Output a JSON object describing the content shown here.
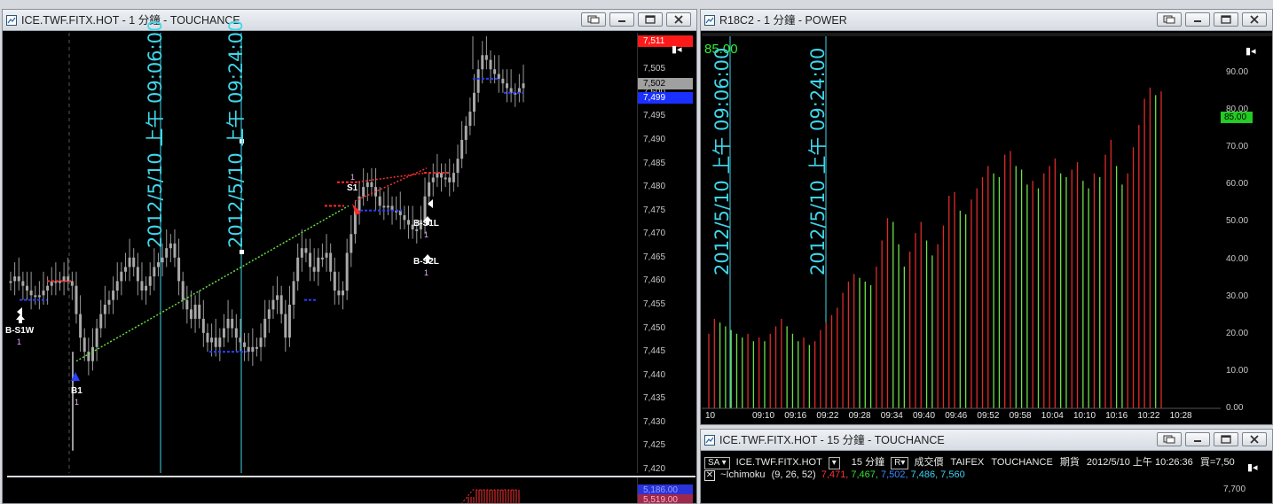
{
  "left_window": {
    "title": "ICE.TWF.FITX.HOT - 1 分鐘 - TOUCHANCE",
    "vertical_labels": [
      "2012/5/10 上午 09:06:00",
      "2012/5/10 上午 09:24:00"
    ],
    "y_ticks": [
      "7,505",
      "7,500",
      "7,495",
      "7,490",
      "7,485",
      "7,480",
      "7,475",
      "7,470",
      "7,465",
      "7,460",
      "7,455",
      "7,450",
      "7,445",
      "7,440",
      "7,435",
      "7,430",
      "7,425",
      "7,420"
    ],
    "price_tags": [
      {
        "text": "7,511",
        "color": "#ff1a1a"
      },
      {
        "text": "7,502",
        "color": "#a0a0a0"
      },
      {
        "text": "7,499",
        "color": "#1a30ff"
      }
    ],
    "signals": [
      {
        "label": "B-S1W",
        "qty": "1"
      },
      {
        "label": "B1",
        "qty": "1"
      },
      {
        "label": "S1",
        "qty": "1"
      },
      {
        "label": "B-S1L",
        "qty": "1"
      },
      {
        "label": "B-S2L",
        "qty": "1"
      }
    ],
    "lower_tags": [
      "5,186.00",
      "5,519.00"
    ],
    "chart_data": {
      "type": "candlestick",
      "title": "",
      "ylim": [
        7420,
        7512
      ],
      "close_series": [
        7460,
        7461,
        7460,
        7459,
        7458,
        7457,
        7457,
        7457,
        7458,
        7459,
        7460,
        7460,
        7460,
        7461,
        7460,
        7459,
        7453,
        7448,
        7445,
        7443,
        7446,
        7450,
        7453,
        7455,
        7456,
        7458,
        7460,
        7462,
        7463,
        7465,
        7463,
        7460,
        7458,
        7459,
        7461,
        7463,
        7464,
        7465,
        7467,
        7468,
        7465,
        7460,
        7456,
        7454,
        7452,
        7455,
        7452,
        7449,
        7447,
        7448,
        7446,
        7448,
        7450,
        7452,
        7450,
        7448,
        7447,
        7446,
        7445,
        7446,
        7446,
        7448,
        7452,
        7454,
        7456,
        7457,
        7453,
        7448,
        7455,
        7460,
        7465,
        7467,
        7466,
        7463,
        7462,
        7465,
        7465,
        7466,
        7462,
        7458,
        7457,
        7458,
        7466,
        7470,
        7475,
        7478,
        7480,
        7481,
        7480,
        7478,
        7476,
        7476,
        7476,
        7475,
        7475,
        7474,
        7473,
        7472,
        7471,
        7471,
        7473,
        7478,
        7481,
        7482,
        7483,
        7482,
        7482,
        7481,
        7483,
        7486,
        7490,
        7493,
        7496,
        7500,
        7505,
        7508,
        7507,
        7505,
        7504,
        7503,
        7502,
        7501,
        7500,
        7500,
        7501,
        7502
      ]
    }
  },
  "right_window": {
    "title": "R18C2 - 1 分鐘 - POWER",
    "value_label": "85.00",
    "vertical_labels": [
      "2012/5/10 上午 09:06:00",
      "2012/5/10 上午 09:24:00"
    ],
    "y_ticks": [
      "90.00",
      "80.00",
      "70.00",
      "60.00",
      "50.00",
      "40.00",
      "30.00",
      "20.00",
      "10.00",
      "0.00"
    ],
    "value_tag": "85.00",
    "x_ticks": [
      "10",
      "09:10",
      "09:16",
      "09:22",
      "09:28",
      "09:34",
      "09:40",
      "09:46",
      "09:52",
      "09:58",
      "10:04",
      "10:10",
      "10:16",
      "10:22",
      "10:28"
    ],
    "chart_data": {
      "type": "bar",
      "title": "",
      "ylim": [
        0,
        95
      ],
      "values": [
        20,
        24,
        23,
        22,
        21,
        20,
        19,
        20,
        18,
        19,
        18,
        20,
        22,
        24,
        22,
        20,
        18,
        19,
        17,
        18,
        21,
        23,
        25,
        27,
        31,
        34,
        36,
        35,
        34,
        33,
        38,
        45,
        51,
        50,
        44,
        38,
        42,
        47,
        50,
        45,
        41,
        44,
        49,
        57,
        58,
        53,
        52,
        56,
        59,
        62,
        65,
        63,
        62,
        68,
        69,
        65,
        64,
        60,
        61,
        59,
        63,
        65,
        67,
        63,
        62,
        64,
        66,
        61,
        59,
        63,
        62,
        68,
        72,
        65,
        60,
        63,
        70,
        76,
        83,
        86,
        84,
        85
      ],
      "colors_pattern": "red when rising, green when falling"
    }
  },
  "bottom_window": {
    "title": "ICE.TWF.FITX.HOT - 15 分鐘 - TOUCHANCE",
    "sa_button": "SA",
    "symbol": "ICE.TWF.FITX.HOT",
    "period": "15 分鐘",
    "field_select": "R",
    "field_label": "成交價",
    "exchange": "TAIFEX",
    "source": "TOUCHANCE",
    "product_type": "期貨",
    "datetime": "2012/5/10 上午 10:26:36",
    "bid_text": "買=7,50",
    "indicator_name": "~Ichimoku",
    "indicator_params": "(9,  26,  52)",
    "indicator_values": [
      {
        "text": "7,471",
        "color": "#ff3030"
      },
      {
        "text": "7,467",
        "color": "#33dd33"
      },
      {
        "text": "7,502",
        "color": "#3a8cff"
      },
      {
        "text": "7,486",
        "color": "#3ad0f0"
      },
      {
        "text": "7,560",
        "color": "#3ad0f0"
      }
    ],
    "y_tick": "7,700"
  }
}
